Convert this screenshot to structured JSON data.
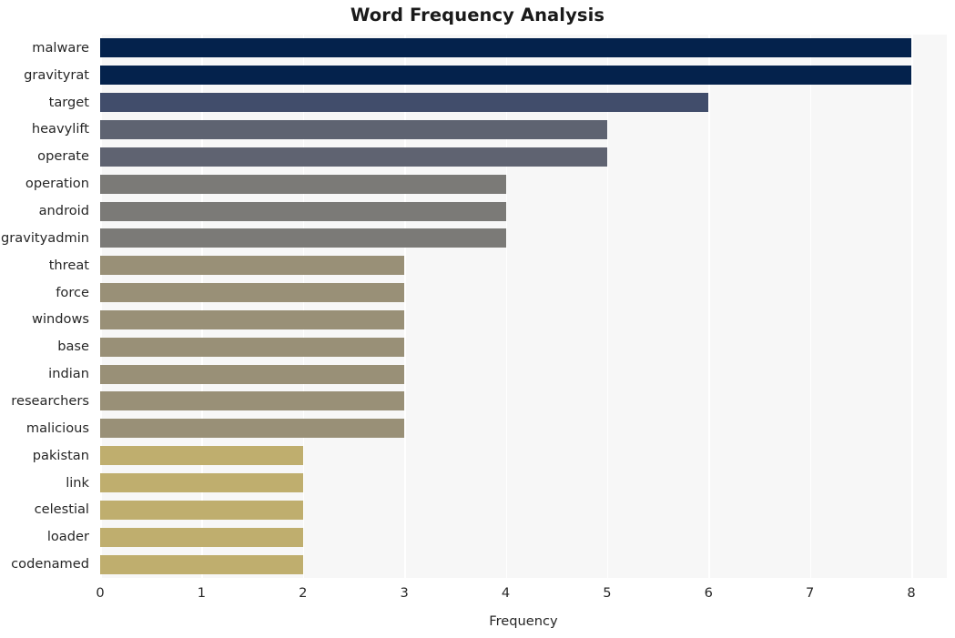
{
  "chart_data": {
    "type": "bar",
    "orientation": "horizontal",
    "title": "Word Frequency Analysis",
    "xlabel": "Frequency",
    "ylabel": "",
    "xlim": [
      0,
      8.35
    ],
    "xticks": [
      0,
      1,
      2,
      3,
      4,
      5,
      6,
      7,
      8
    ],
    "xtick_labels": [
      "0",
      "1",
      "2",
      "3",
      "4",
      "5",
      "6",
      "7",
      "8"
    ],
    "grid": "vertical",
    "legend": "none",
    "categories": [
      "malware",
      "gravityrat",
      "target",
      "heavylift",
      "operate",
      "operation",
      "android",
      "gravityadmin",
      "threat",
      "force",
      "windows",
      "base",
      "indian",
      "researchers",
      "malicious",
      "pakistan",
      "link",
      "celestial",
      "loader",
      "codenamed"
    ],
    "values": [
      8,
      8,
      6,
      5,
      5,
      4,
      4,
      4,
      3,
      3,
      3,
      3,
      3,
      3,
      3,
      2,
      2,
      2,
      2,
      2
    ],
    "bar_colors": [
      "#04224c",
      "#04224c",
      "#414d6b",
      "#5e6371",
      "#5f6371",
      "#7b7a77",
      "#7b7a77",
      "#7b7a77",
      "#999077",
      "#999077",
      "#999077",
      "#999077",
      "#999077",
      "#999077",
      "#999077",
      "#bfae6e",
      "#bfae6e",
      "#bfae6e",
      "#bfae6e",
      "#bfae6e"
    ],
    "plot_background": "#f7f7f7",
    "gridline_color": "#ffffff",
    "figure_background": "#ffffff",
    "text_color": "#262626"
  }
}
